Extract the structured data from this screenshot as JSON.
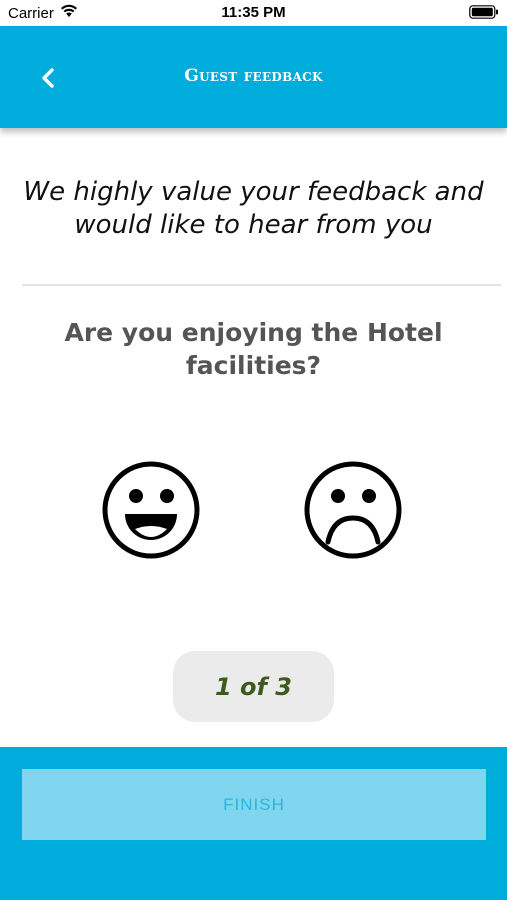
{
  "status_bar": {
    "carrier": "Carrier",
    "time": "11:35 PM"
  },
  "header": {
    "title": "Guest feedback",
    "back_icon": "chevron-left-icon"
  },
  "intro": {
    "text": "We highly value your feedback and would like to hear from you"
  },
  "question": {
    "text": "Are you enjoying the Hotel facilities?"
  },
  "answers": [
    {
      "icon": "happy-face-icon"
    },
    {
      "icon": "sad-face-icon"
    }
  ],
  "progress": {
    "label": "1 of 3",
    "current": 1,
    "total": 3
  },
  "footer": {
    "finish_label": "FINISH"
  },
  "colors": {
    "brand": "#00acdc",
    "finish_bg": "#7fd6ee",
    "finish_text": "#2cb6e0",
    "question_text": "#555555",
    "progress_text": "#3f5a1e"
  }
}
